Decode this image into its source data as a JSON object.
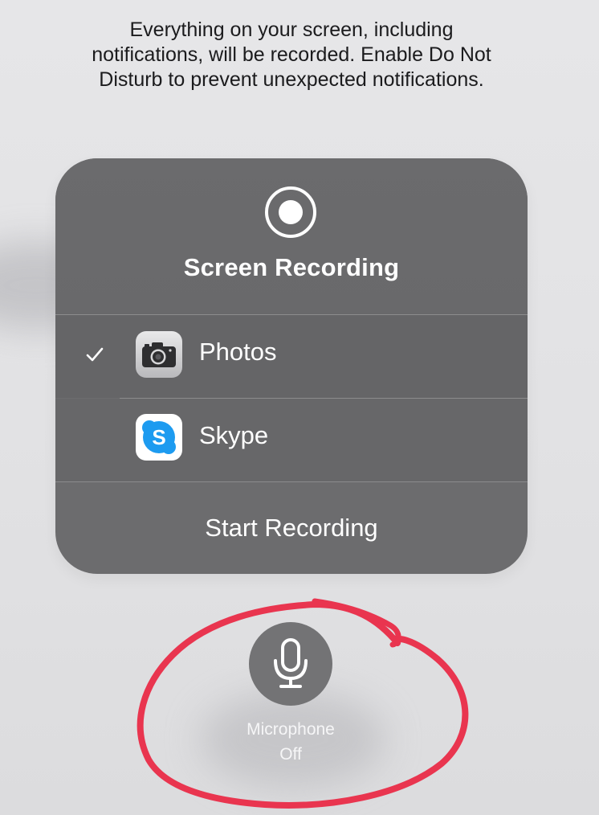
{
  "notice": {
    "line1": "Everything on your screen, including",
    "line2": "notifications, will be recorded. Enable Do Not",
    "line3": "Disturb to prevent unexpected notifications."
  },
  "panel": {
    "title": "Screen Recording",
    "icon": "record-icon",
    "destinations": [
      {
        "label": "Photos",
        "icon": "photos-camera-icon",
        "selected": true
      },
      {
        "label": "Skype",
        "icon": "skype-icon",
        "selected": false
      }
    ],
    "start_label": "Start Recording"
  },
  "microphone": {
    "icon": "microphone-icon",
    "label": "Microphone",
    "state": "Off"
  },
  "annotation": {
    "color": "#e9354f",
    "description": "hand-drawn circle around microphone button"
  },
  "colors": {
    "panel_bg": "#6c6c6e",
    "mic_button_bg": "#737375",
    "skype_blue": "#1d9bf0"
  }
}
